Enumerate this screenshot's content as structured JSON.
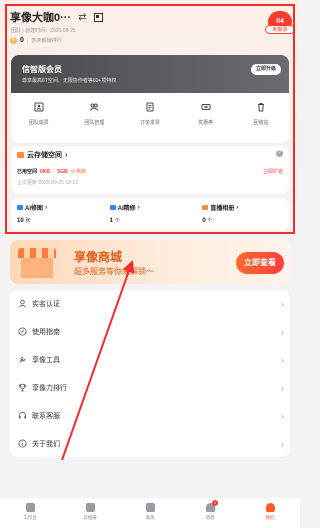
{
  "header": {
    "title": "享像大咖0···",
    "meta": "团队 | 创建时间：2025-09-25",
    "points": "0",
    "points_label": "暂未解锁排行",
    "days_badge": "04",
    "days_label": "到期录"
  },
  "vip": {
    "title": "信智版会员",
    "subtitle": "尊享最高6T空间、无限协作者等60+项特权",
    "upgrade_label": "立即升级",
    "icons": [
      {
        "label": "团队成员"
      },
      {
        "label": "团队管理"
      },
      {
        "label": "订单发票"
      },
      {
        "label": "优惠券"
      },
      {
        "label": "回收站"
      }
    ]
  },
  "cloud": {
    "title": "云存储空间",
    "used_label": "已用空间",
    "used_value": "0KB",
    "total_value": "5GB",
    "refresh_label": "刷新",
    "expand_label": "立即扩容",
    "updated": "上次更新 2025-09-25 18:13"
  },
  "stats": [
    {
      "title": "AI修图",
      "value": "10",
      "unit": "张",
      "color": "#3b82f6"
    },
    {
      "title": "AI精修",
      "value": "1",
      "unit": "个",
      "color": "#3b82f6"
    },
    {
      "title": "直播相册",
      "value": "0",
      "unit": "个",
      "color": "#ff8a3d"
    }
  ],
  "mall": {
    "title": "享像商城",
    "subtitle": "超多服务等你来解锁～",
    "button": "立即查看"
  },
  "menu": [
    {
      "label": "实名认证",
      "icon": "person-icon"
    },
    {
      "label": "使用指南",
      "icon": "compass-icon"
    },
    {
      "label": "享像工具",
      "icon": "tool-icon"
    },
    {
      "label": "享像力排行",
      "icon": "trophy-icon"
    },
    {
      "label": "联系客服",
      "icon": "headset-icon"
    },
    {
      "label": "关于我们",
      "icon": "info-icon"
    }
  ],
  "tabs": [
    {
      "label": "工作台"
    },
    {
      "label": "云相册"
    },
    {
      "label": "发现"
    },
    {
      "label": "消息",
      "badge": "1"
    },
    {
      "label": "我的"
    }
  ],
  "colors": {
    "accent": "#ff5a2a",
    "highlight_box": "#ef2d2d"
  }
}
